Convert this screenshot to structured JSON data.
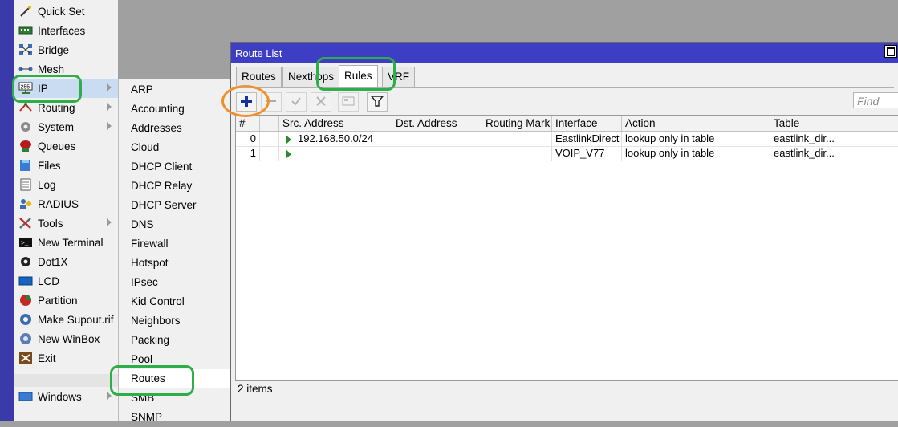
{
  "main_menu": {
    "items": [
      {
        "label": "Quick Set",
        "icon": "wand-icon"
      },
      {
        "label": "Interfaces",
        "icon": "interfaces-icon"
      },
      {
        "label": "Bridge",
        "icon": "bridge-icon"
      },
      {
        "label": "Mesh",
        "icon": "mesh-icon"
      },
      {
        "label": "IP",
        "icon": "ip-icon"
      },
      {
        "label": "Routing",
        "icon": "routing-icon"
      },
      {
        "label": "System",
        "icon": "gear-icon"
      },
      {
        "label": "Queues",
        "icon": "queues-icon"
      },
      {
        "label": "Files",
        "icon": "folder-icon"
      },
      {
        "label": "Log",
        "icon": "log-icon"
      },
      {
        "label": "RADIUS",
        "icon": "radius-icon"
      },
      {
        "label": "Tools",
        "icon": "tools-icon"
      },
      {
        "label": "New Terminal",
        "icon": "terminal-icon"
      },
      {
        "label": "Dot1X",
        "icon": "dot1x-icon"
      },
      {
        "label": "LCD",
        "icon": "lcd-icon"
      },
      {
        "label": "Partition",
        "icon": "partition-icon"
      },
      {
        "label": "Make Supout.rif",
        "icon": "supout-icon"
      },
      {
        "label": "New WinBox",
        "icon": "winbox-icon"
      },
      {
        "label": "Exit",
        "icon": "exit-icon"
      },
      {
        "label": "Windows",
        "icon": "windows-icon"
      }
    ]
  },
  "ip_submenu": {
    "items": [
      "ARP",
      "Accounting",
      "Addresses",
      "Cloud",
      "DHCP Client",
      "DHCP Relay",
      "DHCP Server",
      "DNS",
      "Firewall",
      "Hotspot",
      "IPsec",
      "Kid Control",
      "Neighbors",
      "Packing",
      "Pool",
      "Routes",
      "SMB",
      "SNMP"
    ]
  },
  "window": {
    "title": "Route List",
    "tabs": [
      "Routes",
      "Nexthops",
      "Rules",
      "VRF"
    ],
    "active_tab": "Rules",
    "find_placeholder": "Find",
    "columns": [
      "#",
      "",
      "Src. Address",
      "Dst. Address",
      "Routing Mark",
      "Interface",
      "Action",
      "Table"
    ],
    "rows": [
      {
        "num": "0",
        "src": "192.168.50.0/24",
        "dst": "",
        "mark": "",
        "interface": "EastlinkDirect",
        "action": "lookup only in table",
        "table": "eastlink_dir..."
      },
      {
        "num": "1",
        "src": "",
        "dst": "",
        "mark": "",
        "interface": "VOIP_V77",
        "action": "lookup only in table",
        "table": "eastlink_dir..."
      }
    ],
    "status": "2 items"
  },
  "colors": {
    "accent": "#3e3ec4",
    "highlight_green": "#2eae49",
    "highlight_orange": "#f0902a"
  }
}
